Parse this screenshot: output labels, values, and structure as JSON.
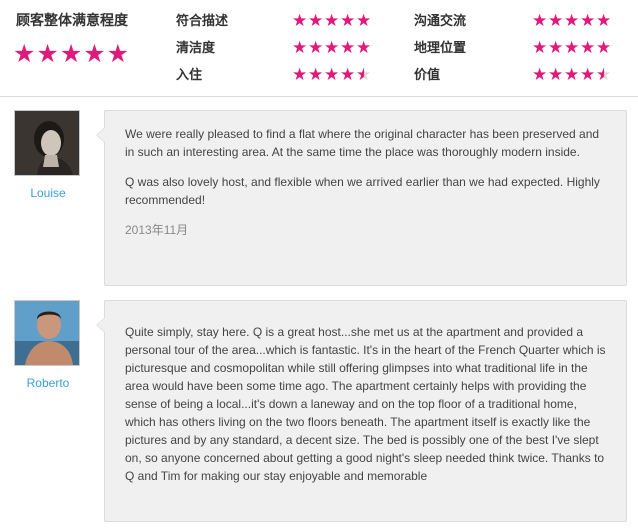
{
  "ratings": {
    "overall": {
      "label": "顾客整体满意程度",
      "stars": "★★★★★",
      "value": 5
    },
    "categories": [
      {
        "label": "符合描述",
        "value": 5
      },
      {
        "label": "沟通交流",
        "value": 5
      },
      {
        "label": "清洁度",
        "value": 5
      },
      {
        "label": "地理位置",
        "value": 5
      },
      {
        "label": "入住",
        "value": 4.5
      },
      {
        "label": "价值",
        "value": 4.5
      }
    ],
    "star_color": "#e01a7a"
  },
  "reviews": [
    {
      "name": "Louise",
      "paragraphs": [
        "We were really pleased to find a flat where the original character has been preserved and in such an interesting area. At the same time the place was thoroughly modern inside.",
        "Q was also lovely host, and flexible when we arrived earlier than we had expected. Highly recommended!"
      ],
      "date": "2013年11月"
    },
    {
      "name": "Roberto",
      "paragraphs": [
        "Quite simply, stay here. Q is a great host...she met us at the apartment and provided a personal tour of the area...which is fantastic. It's in the heart of the French Quarter which is picturesque and cosmopolitan while still offering glimpses into what traditional life in the area would have been some time ago. The apartment certainly helps with providing the sense of being a local...it's down a laneway and on the top floor of a traditional home, which has others living on the two floors beneath. The apartment itself is exactly like the pictures and by any standard, a decent size. The bed is possibly one of the best I've slept on, so anyone concerned about getting a good night's sleep needed think twice. Thanks to Q and Tim for making our stay enjoyable and memorable"
      ]
    }
  ]
}
